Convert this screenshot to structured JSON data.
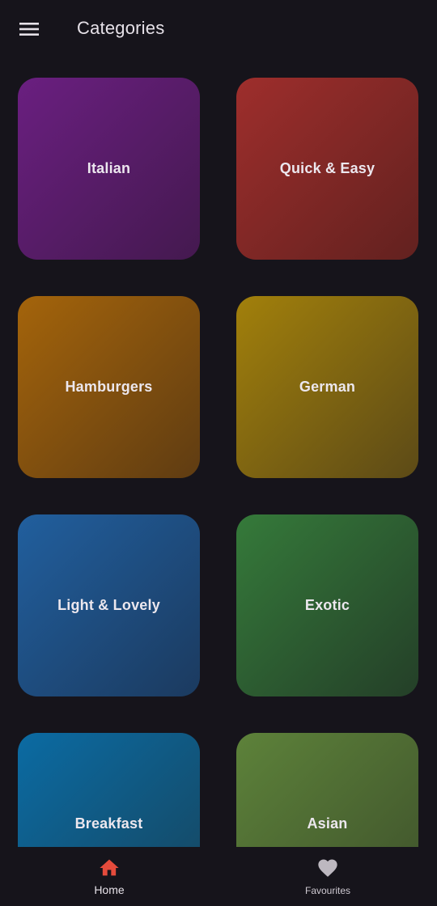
{
  "app_bar": {
    "title": "Categories",
    "menu_icon": "menu-icon"
  },
  "categories": [
    {
      "label": "Italian",
      "color": "#6a1f80"
    },
    {
      "label": "Quick & Easy",
      "color": "#9e2e2c"
    },
    {
      "label": "Hamburgers",
      "color": "#a4640b"
    },
    {
      "label": "German",
      "color": "#a2800b"
    },
    {
      "label": "Light & Lovely",
      "color": "#215f9e"
    },
    {
      "label": "Exotic",
      "color": "#357a3a"
    },
    {
      "label": "Breakfast",
      "color": "#0b6ba3"
    },
    {
      "label": "Asian",
      "color": "#5d823a"
    }
  ],
  "bottom_nav": {
    "items": [
      {
        "label": "Home",
        "icon": "home-icon",
        "selected": true,
        "color": "#e54b3c"
      },
      {
        "label": "Favourites",
        "icon": "heart-icon",
        "selected": false,
        "color": "#bdb8c0"
      }
    ]
  },
  "colors": {
    "background": "#16141b",
    "text": "#e6e1e8"
  }
}
